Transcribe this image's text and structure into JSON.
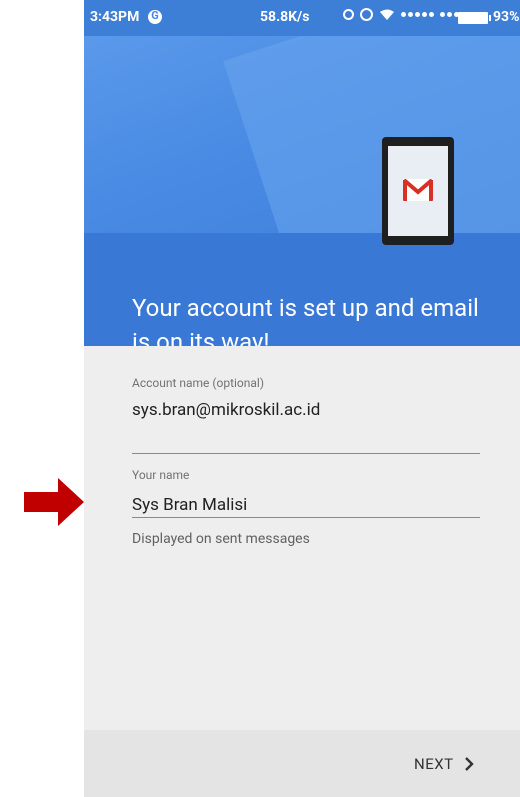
{
  "status_bar": {
    "time": "3:43PM",
    "speed": "58.8K/s",
    "battery": "93%"
  },
  "header": {
    "title": "Your account is set up and email is on its way!",
    "colors": {
      "primary": "#3f80dc",
      "band": "#3a78d6",
      "gmail_red": "#d93025"
    }
  },
  "form": {
    "account_name": {
      "label": "Account name (optional)",
      "value": "sys.bran@mikroskil.ac.id"
    },
    "your_name": {
      "label": "Your name",
      "value": "Sys Bran Malisi",
      "hint": "Displayed on sent messages"
    }
  },
  "footer": {
    "next_label": "NEXT"
  },
  "annotation": {
    "arrow_color": "#c00000"
  },
  "icons": [
    "google-icon",
    "sync-icon",
    "alarm-icon",
    "wifi-icon",
    "signal-icon",
    "battery-icon",
    "gmail-icon",
    "chevron-right-icon",
    "arrow-right-icon"
  ]
}
